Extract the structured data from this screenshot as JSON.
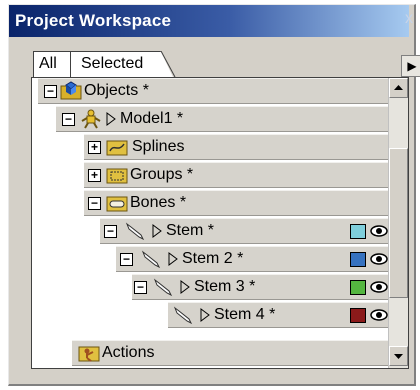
{
  "window": {
    "title": "Project Workspace",
    "close_glyph": "x"
  },
  "tabs": [
    {
      "label": "All",
      "active": true
    },
    {
      "label": "Selected",
      "active": false
    }
  ],
  "nav_glyph": "▶",
  "tree": {
    "objects": {
      "label": "Objects *",
      "expander": "⊟",
      "icon": "folder-icon"
    },
    "model1": {
      "label": "Model1 *",
      "expander": "⊟",
      "icon": "model-icon"
    },
    "splines": {
      "label": "Splines",
      "expander": "⊞",
      "icon": "splines-folder-icon"
    },
    "groups": {
      "label": "Groups *",
      "expander": "⊞",
      "icon": "groups-folder-icon"
    },
    "bones": {
      "label": "Bones *",
      "expander": "⊟",
      "icon": "bones-folder-icon"
    },
    "stem": {
      "label": "Stem *",
      "expander": "⊟",
      "icon": "bone-icon",
      "color": "#7fcfdc"
    },
    "stem2": {
      "label": "Stem 2 *",
      "expander": "⊟",
      "icon": "bone-icon",
      "color": "#3672c0"
    },
    "stem3": {
      "label": "Stem 3 *",
      "expander": "⊟",
      "icon": "bone-icon",
      "color": "#54b640"
    },
    "stem4": {
      "label": "Stem 4 *",
      "icon": "bone-icon",
      "color": "#8b1a1a"
    },
    "actions": {
      "label": "Actions",
      "icon": "actions-folder-icon"
    }
  },
  "scrollbar": {
    "up_glyph": "▲",
    "down_glyph": "▼"
  },
  "colors": {
    "titlebar_start": "#0a246a",
    "titlebar_end": "#a6caf0",
    "row_bg": "#d6d3cc"
  }
}
